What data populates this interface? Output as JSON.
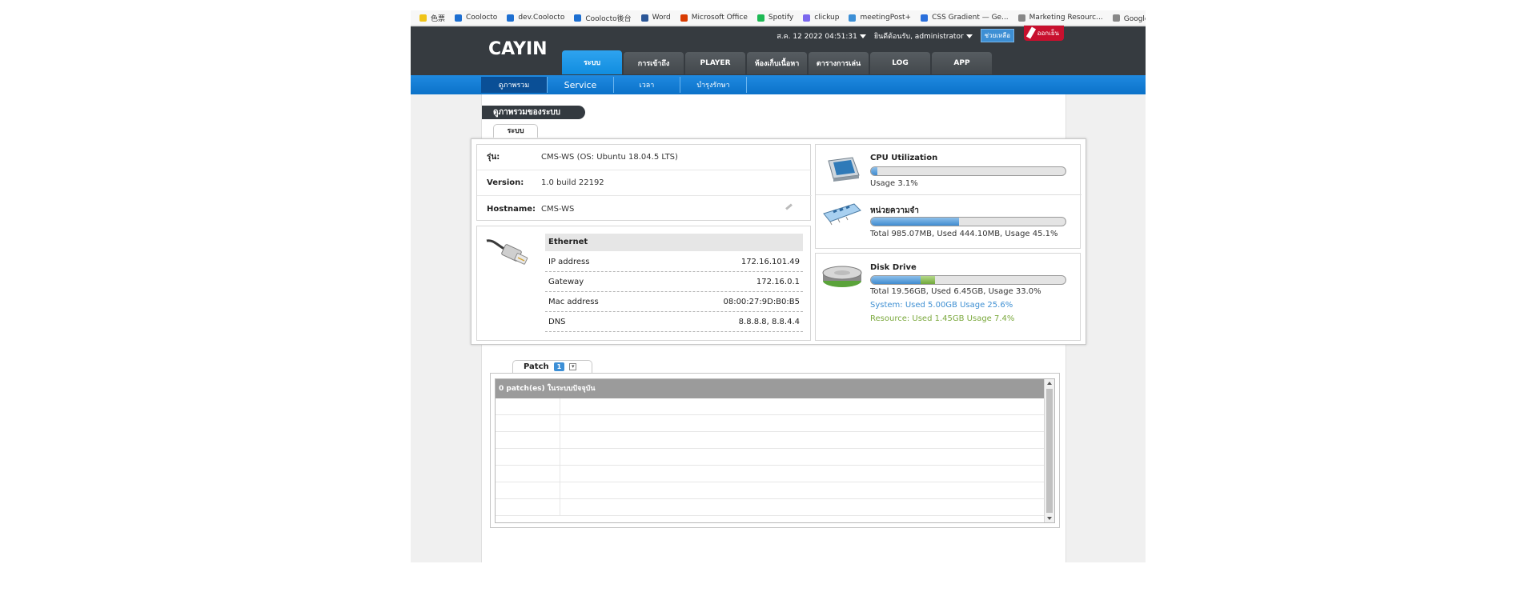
{
  "bookmarks": [
    {
      "label": "色票",
      "color": "#f0c419"
    },
    {
      "label": "Coolocto",
      "color": "#1d6fd1"
    },
    {
      "label": "dev.Coolocto",
      "color": "#1d6fd1"
    },
    {
      "label": "Coolocto後台",
      "color": "#1d6fd1"
    },
    {
      "label": "Word",
      "color": "#2b5797"
    },
    {
      "label": "Microsoft Office",
      "color": "#d83b01"
    },
    {
      "label": "Spotify",
      "color": "#1db954"
    },
    {
      "label": "clickup",
      "color": "#7b68ee"
    },
    {
      "label": "meetingPost+",
      "color": "#3c8fd6"
    },
    {
      "label": "CSS Gradient — Ge...",
      "color": "#2a6fdb"
    },
    {
      "label": "Marketing Resourc...",
      "color": "#888888"
    },
    {
      "label": "Google Play 徽章",
      "color": "#888888"
    }
  ],
  "header": {
    "logo": "CAYIN",
    "datetime": "ส.ค. 12 2022 04:51:31",
    "welcome": "ยินดีต้อนรับ, administrator",
    "help_label": "ช่วยเหลือ",
    "logout_label": "ออกเย็น"
  },
  "main_nav": [
    {
      "label": "ระบบ",
      "active": true
    },
    {
      "label": "การเข้าถึง",
      "active": false
    },
    {
      "label": "PLAYER",
      "active": false
    },
    {
      "label": "ห้องเก็บเนื้อหา",
      "active": false
    },
    {
      "label": "ตารางการเล่น",
      "active": false
    },
    {
      "label": "LOG",
      "active": false
    },
    {
      "label": "APP",
      "active": false
    }
  ],
  "sub_nav": [
    {
      "label": "ดูภาพรวม",
      "active": true
    },
    {
      "label": "Service",
      "active": false
    },
    {
      "label": "เวลา",
      "active": false
    },
    {
      "label": "บำรุงรักษา",
      "active": false
    }
  ],
  "page_title": "ดูภาพรวมของระบบ",
  "system_tab": "ระบบ",
  "info": {
    "model_label": "รุ่น:",
    "model_value": "CMS-WS (OS: Ubuntu 18.04.5 LTS)",
    "version_label": "Version:",
    "version_value": "1.0 build 22192",
    "hostname_label": "Hostname:",
    "hostname_value": "CMS-WS"
  },
  "ethernet": {
    "title": "Ethernet",
    "rows": [
      {
        "label": "IP address",
        "value": "172.16.101.49"
      },
      {
        "label": "Gateway",
        "value": "172.16.0.1"
      },
      {
        "label": "Mac address",
        "value": "08:00:27:9D:B0:B5"
      },
      {
        "label": "DNS",
        "value": "8.8.8.8, 8.8.4.4"
      }
    ]
  },
  "cpu": {
    "title": "CPU Utilization",
    "text": "Usage 3.1%",
    "usage_percent": 3.1
  },
  "memory": {
    "title": "หน่วยความจำ",
    "text": "Total 985.07MB, Used 444.10MB, Usage 45.1%",
    "usage_percent": 45.1
  },
  "disk": {
    "title": "Disk Drive",
    "text": "Total 19.56GB, Used 6.45GB, Usage 33.0%",
    "system_text": "System: Used 5.00GB Usage 25.6%",
    "resource_text": "Resource: Used 1.45GB Usage 7.4%",
    "system_percent": 25.6,
    "resource_percent": 7.4,
    "system_color": "#3e8fd2",
    "resource_color": "#7aa83c"
  },
  "patch": {
    "tab_label": "Patch",
    "count": "1",
    "toggle": "▾",
    "header": "0 patch(es) ในระบบปัจจุบัน"
  }
}
